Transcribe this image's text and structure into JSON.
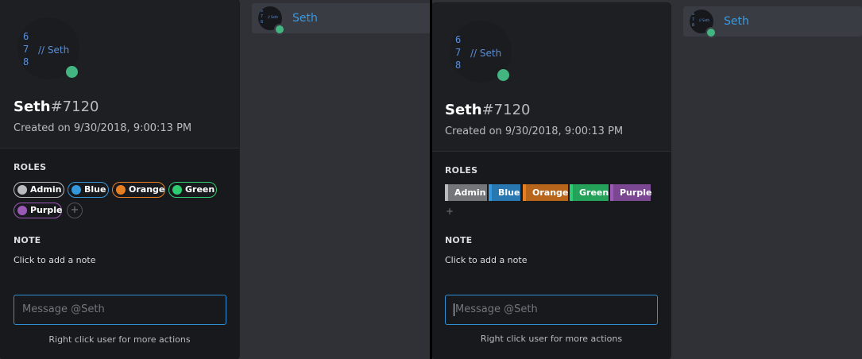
{
  "user": {
    "name": "Seth",
    "discriminator": "#7120",
    "created": "Created on 9/30/2018, 9:00:13 PM",
    "avatar_line_numbers": [
      "6",
      "7",
      "8"
    ],
    "avatar_code": "// Seth",
    "status_color": "#43b581"
  },
  "sections": {
    "roles_label": "ROLES",
    "note_label": "NOTE",
    "note_placeholder": "Click to add a note"
  },
  "roles": [
    {
      "name": "Admin",
      "color": "#b9bbbe"
    },
    {
      "name": "Blue",
      "color": "#3498db"
    },
    {
      "name": "Orange",
      "color": "#e67e22"
    },
    {
      "name": "Green",
      "color": "#2ecc71"
    },
    {
      "name": "Purple",
      "color": "#9b59b6"
    }
  ],
  "add_role_symbol": "+",
  "message": {
    "placeholder": "Message @Seth",
    "hint": "Right click user for more actions"
  },
  "member_list": {
    "name": "Seth",
    "mini_lines": "6\n7\n8",
    "mini_code": "// Seth"
  },
  "colors": {
    "accent": "#3a9ae0",
    "input_border": "#2f8fd4"
  }
}
